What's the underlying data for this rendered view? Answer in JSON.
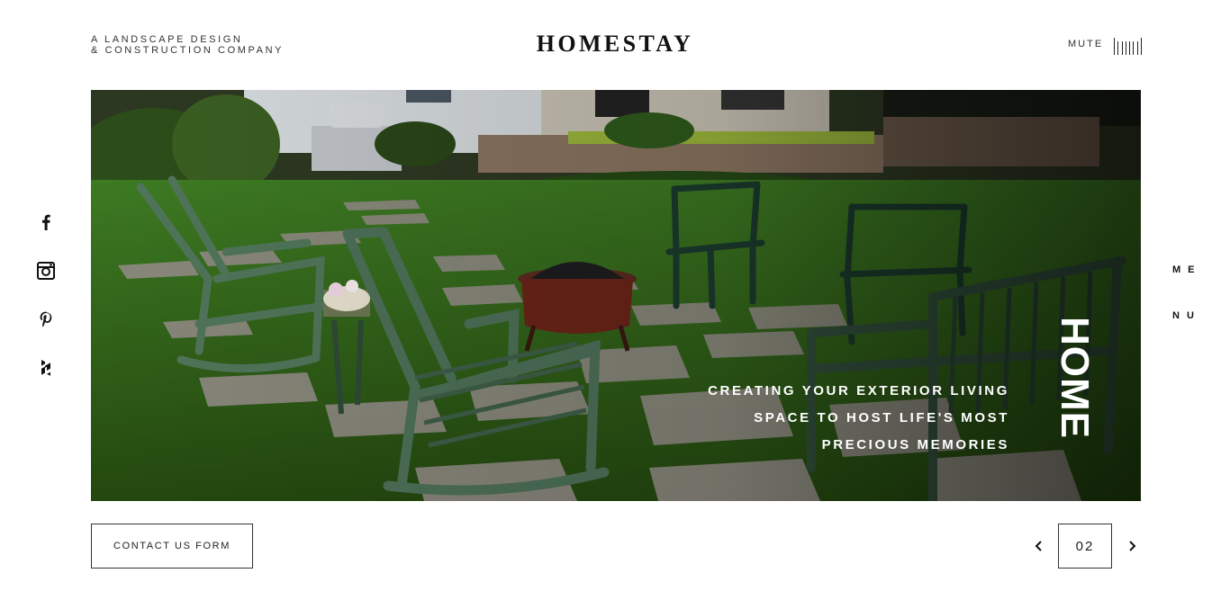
{
  "header": {
    "tagline_line1": "A LANDSCAPE DESIGN",
    "tagline_line2": "& CONSTRUCTION COMPANY",
    "logo": "HOMESTAY",
    "mute_label": "MUTE"
  },
  "social": [
    {
      "icon": "facebook-icon"
    },
    {
      "icon": "instagram-icon"
    },
    {
      "icon": "pinterest-icon"
    },
    {
      "icon": "houzz-icon"
    }
  ],
  "hero": {
    "caption_line1": "CREATING YOUR EXTERIOR LIVING",
    "caption_line2": "SPACE TO HOST LIFE'S MOST",
    "caption_line3": "PRECIOUS MEMORIES",
    "section_label": "HOME",
    "image_subject": "backyard patio with green adirondack chairs, fire pit and stepping stones"
  },
  "side_menu": {
    "part1": "ME",
    "part2": "NU"
  },
  "footer": {
    "contact_label": "CONTACT US FORM",
    "page_number": "02",
    "prev_icon": "chevron-left-icon",
    "next_icon": "chevron-right-icon"
  },
  "colors": {
    "text": "#222222",
    "background": "#ffffff",
    "caption": "#ffffff"
  }
}
